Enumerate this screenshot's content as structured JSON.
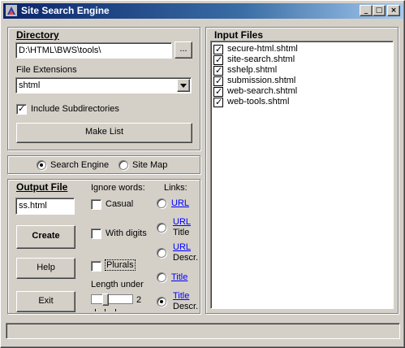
{
  "window": {
    "title": "Site Search Engine",
    "minimize": "_",
    "maximize": "□",
    "close": "×"
  },
  "directory": {
    "heading": "Directory",
    "path": "D:\\HTML\\BWS\\tools\\",
    "browse_label": "...",
    "ext_label": "File Extensions",
    "ext_value": "shtml",
    "include_subdirs_label": "Include Subdirectories",
    "include_subdirs_checked": true,
    "make_list_label": "Make List"
  },
  "mode": {
    "search_engine_label": "Search Engine",
    "site_map_label": "Site Map",
    "selected": "search_engine"
  },
  "output": {
    "heading": "Output File",
    "file_value": "ss.html",
    "create_label": "Create",
    "help_label": "Help",
    "exit_label": "Exit"
  },
  "ignore": {
    "heading": "Ignore words:",
    "casual_label": "Casual",
    "digits_label": "With digits",
    "plurals_label": "Plurals",
    "length_label": "Length under",
    "length_value": "2"
  },
  "links": {
    "heading": "Links:",
    "options": [
      {
        "line1": "URL",
        "line2": ""
      },
      {
        "line1": "URL",
        "line2": "Title"
      },
      {
        "line1": "URL",
        "line2": "Descr."
      },
      {
        "line1": "Title",
        "line2": ""
      },
      {
        "line1": "Title",
        "line2": "Descr."
      }
    ],
    "selected_index": 4
  },
  "input_files": {
    "heading": "Input Files",
    "files": [
      "secure-html.shtml",
      "site-search.shtml",
      "sshelp.shtml",
      "submission.shtml",
      "web-search.shtml",
      "web-tools.shtml"
    ]
  },
  "status": {
    "text": ""
  }
}
